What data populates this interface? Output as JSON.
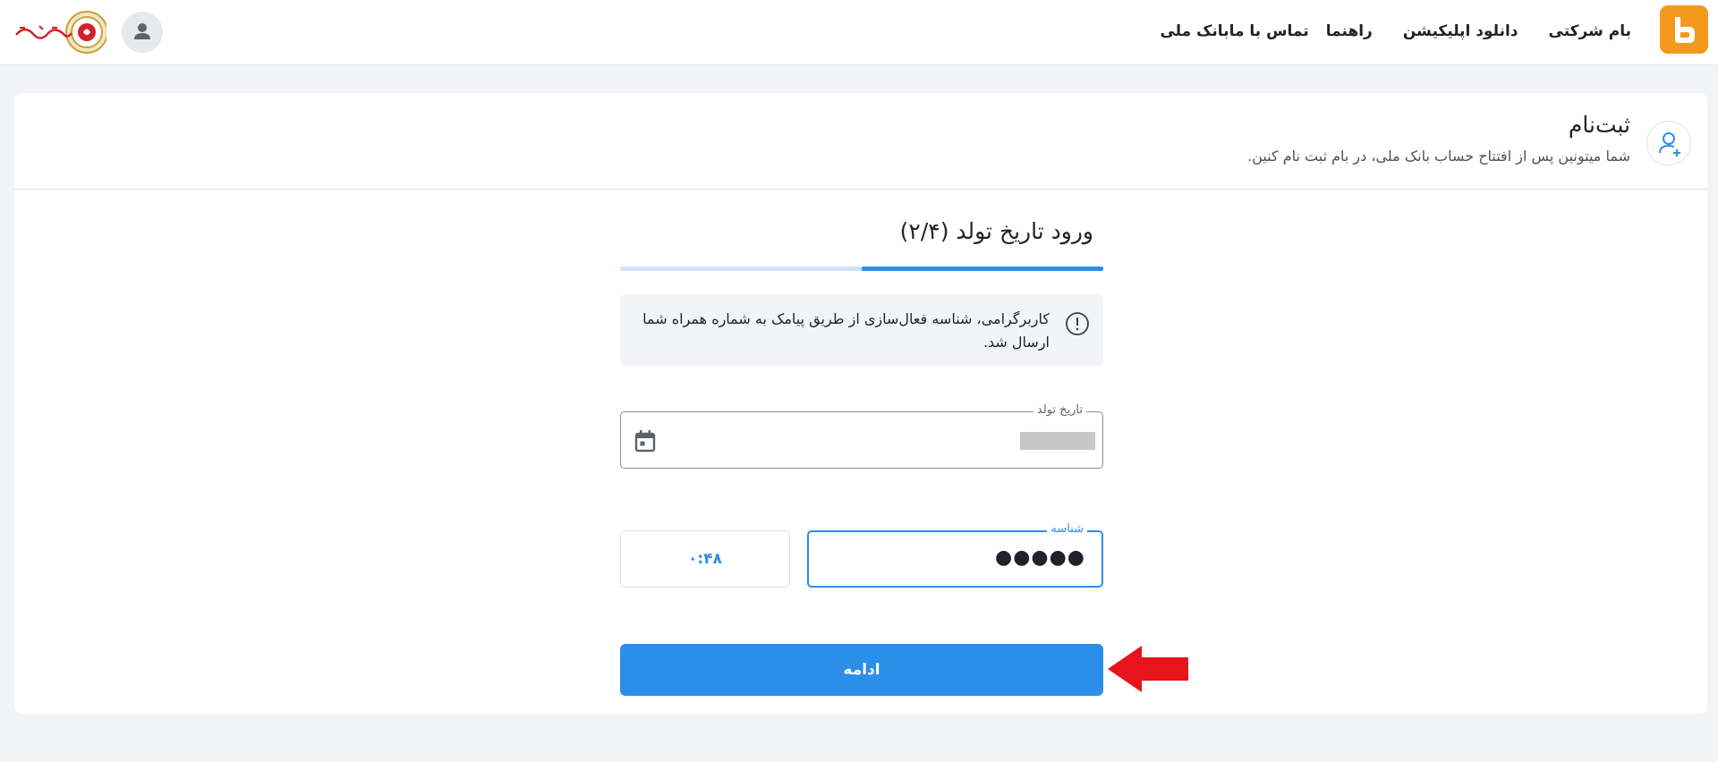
{
  "nav": {
    "brand": "بانک ملی",
    "items": [
      "تماس با ما",
      "راهنما",
      "دانلود اپلیکیشن",
      "بام شرکتی"
    ]
  },
  "header": {
    "title": "ثبت‌نام",
    "subtitle": "شما میتونین پس از افتتاح حساب بانک ملی، در بام ثبت نام کنین."
  },
  "step": {
    "title": "ورود تاریخ تولد (۲/۴)",
    "progress": 0.5
  },
  "alert": {
    "text": "کاربرگرامی، شناسه فعال‌سازی از طریق پیامک به شماره همراه شما ارسال شد."
  },
  "form": {
    "birth_date_label": "تاریخ تولد",
    "code_label": "شناسه",
    "code_value": "●●●●●",
    "timer": "۰:۴۸",
    "continue_label": "ادامه"
  },
  "colors": {
    "brand_orange": "#f39a1e",
    "primary_blue": "#2b8fea",
    "arrow_red": "#e8141c"
  },
  "icons": [
    "bam-logo-icon",
    "user-avatar-icon",
    "bank-melli-logo",
    "user-plus-icon",
    "info-icon",
    "calendar-icon",
    "red-arrow-icon"
  ]
}
